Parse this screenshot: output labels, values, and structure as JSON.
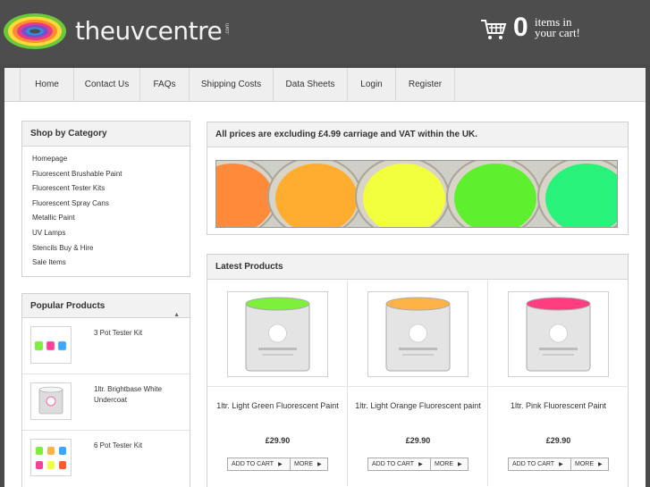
{
  "header": {
    "logo_text": "theuvcentre",
    "logo_suffix": ".com",
    "cart_count": "0",
    "cart_line1": "items in",
    "cart_line2": "your cart!"
  },
  "nav": [
    "Home",
    "Contact Us",
    "FAQs",
    "Shipping Costs",
    "Data Sheets",
    "Login",
    "Register"
  ],
  "category": {
    "title": "Shop by Category",
    "items": [
      "Homepage",
      "Fluorescent Brushable Paint",
      "Fluorescent Tester Kits",
      "Fluorescent Spray Cans",
      "Metallic Paint",
      "UV Lamps",
      "Stencils Buy & Hire",
      "Sale Items"
    ]
  },
  "popular": {
    "title": "Popular Products",
    "items": [
      {
        "name": "3 Pot Tester Kit"
      },
      {
        "name": "1ltr. Brightbase White Undercoat"
      },
      {
        "name": "6 Pot Tester Kit"
      }
    ]
  },
  "notice": "All prices are excluding £4.99 carriage and VAT within the UK.",
  "latest": {
    "title": "Latest Products",
    "add_label": "ADD TO CART",
    "more_label": "MORE",
    "products": [
      {
        "name": "1ltr. Light Green Fluorescent Paint",
        "price": "£29.90",
        "color": "#7cf03a"
      },
      {
        "name": "1ltr. Light Orange Fluorescent paint",
        "price": "£29.90",
        "color": "#ffb347"
      },
      {
        "name": "1ltr. Pink Fluorescent Paint",
        "price": "£29.90",
        "color": "#ff3d7f"
      }
    ]
  },
  "colors": {
    "header_bg": "#4d4d4d",
    "banner_paints": [
      "#ff8a3a",
      "#ffad2e",
      "#f2ff3c",
      "#5ef02e",
      "#29f27a"
    ]
  }
}
